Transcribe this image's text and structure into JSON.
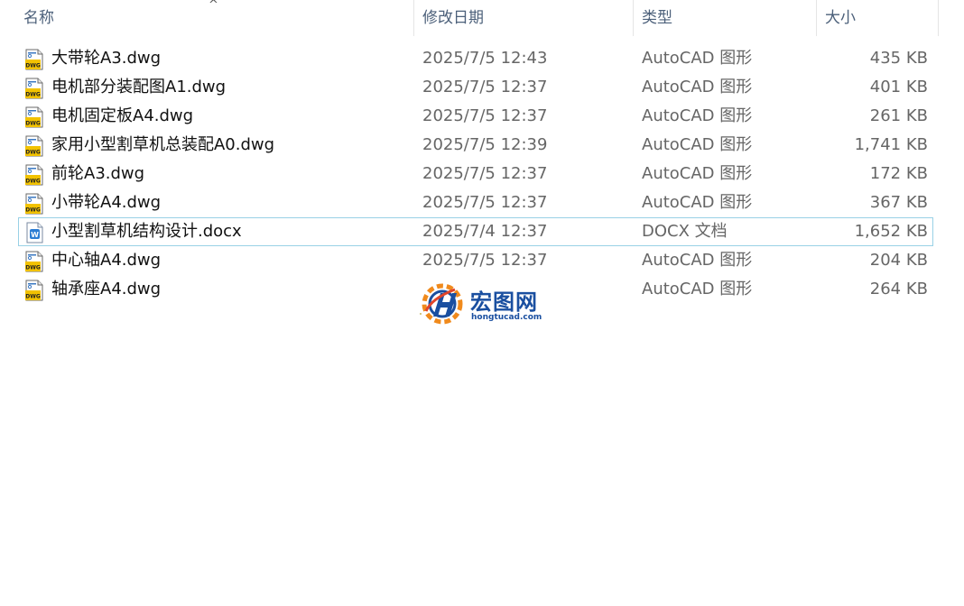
{
  "header": {
    "name": "名称",
    "date": "修改日期",
    "type": "类型",
    "size": "大小",
    "sort_indicator": "^"
  },
  "files": [
    {
      "name": "大带轮A3.dwg",
      "date": "2025/7/5 12:43",
      "type": "AutoCAD 图形",
      "size": "435 KB",
      "icon": "dwg-file-icon"
    },
    {
      "name": "电机部分装配图A1.dwg",
      "date": "2025/7/5 12:37",
      "type": "AutoCAD 图形",
      "size": "401 KB",
      "icon": "dwg-file-icon"
    },
    {
      "name": "电机固定板A4.dwg",
      "date": "2025/7/5 12:37",
      "type": "AutoCAD 图形",
      "size": "261 KB",
      "icon": "dwg-file-icon"
    },
    {
      "name": "家用小型割草机总装配A0.dwg",
      "date": "2025/7/5 12:39",
      "type": "AutoCAD 图形",
      "size": "1,741 KB",
      "icon": "dwg-file-icon"
    },
    {
      "name": "前轮A3.dwg",
      "date": "2025/7/5 12:37",
      "type": "AutoCAD 图形",
      "size": "172 KB",
      "icon": "dwg-file-icon"
    },
    {
      "name": "小带轮A4.dwg",
      "date": "2025/7/5 12:37",
      "type": "AutoCAD 图形",
      "size": "367 KB",
      "icon": "dwg-file-icon"
    },
    {
      "name": "小型割草机结构设计.docx",
      "date": "2025/7/4 12:37",
      "type": "DOCX 文档",
      "size": "1,652 KB",
      "icon": "word-file-icon",
      "selected": true
    },
    {
      "name": "中心轴A4.dwg",
      "date": "2025/7/5 12:37",
      "type": "AutoCAD 图形",
      "size": "204 KB",
      "icon": "dwg-file-icon"
    },
    {
      "name": "轴承座A4.dwg",
      "date": "",
      "type": "AutoCAD 图形",
      "size": "264 KB",
      "icon": "dwg-file-icon"
    }
  ],
  "watermark": {
    "title": "宏图网",
    "subtitle": "hongtucad.com"
  },
  "colors": {
    "header_text": "#4c607a",
    "selection_border": "#99d1e6",
    "dwg_icon": "#f2c200",
    "docx_icon": "#2b7cd3",
    "watermark": "#1a4fa0"
  }
}
